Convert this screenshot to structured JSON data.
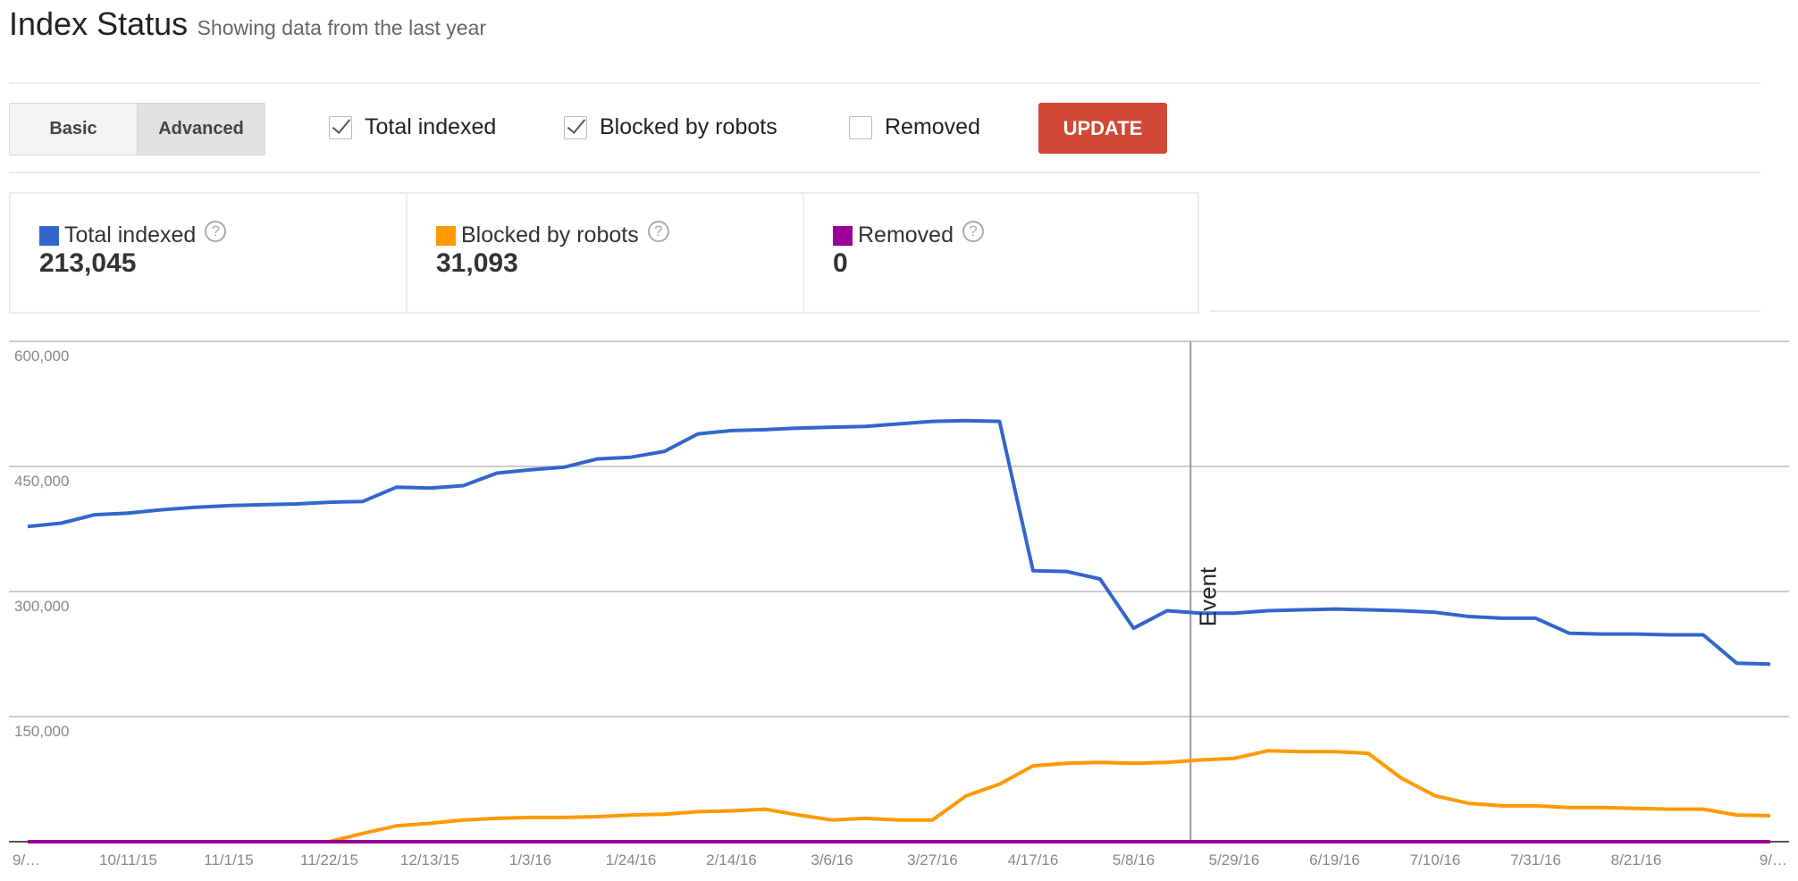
{
  "header": {
    "title": "Index Status",
    "subtitle": "Showing data from the last year"
  },
  "view_toggle": {
    "options": [
      "Basic",
      "Advanced"
    ],
    "selected": "Advanced"
  },
  "filters": [
    {
      "label": "Total indexed",
      "checked": true
    },
    {
      "label": "Blocked by robots",
      "checked": true
    },
    {
      "label": "Removed",
      "checked": false
    }
  ],
  "update_label": "UPDATE",
  "colors": {
    "total": "#3366cc",
    "blocked": "#ff9900",
    "removed": "#990099",
    "update": "#d14836"
  },
  "stats": [
    {
      "label": "Total indexed",
      "value": "213,045",
      "color": "#3366cc",
      "help": "?"
    },
    {
      "label": "Blocked by robots",
      "value": "31,093",
      "color": "#ff9900",
      "help": "?"
    },
    {
      "label": "Removed",
      "value": "0",
      "color": "#990099",
      "help": "?"
    }
  ],
  "chart_data": {
    "type": "line",
    "title": "",
    "xlabel": "",
    "ylabel": "",
    "ylim": [
      0,
      600000
    ],
    "yticks": [
      0,
      150000,
      300000,
      450000,
      600000
    ],
    "ytick_labels": [
      "",
      "150,000",
      "300,000",
      "450,000",
      "600,000"
    ],
    "x_tick_labels": [
      "9/…",
      "10/11/15",
      "11/1/15",
      "11/22/15",
      "12/13/15",
      "1/3/16",
      "1/24/16",
      "2/14/16",
      "3/6/16",
      "3/27/16",
      "4/17/16",
      "5/8/16",
      "5/29/16",
      "6/19/16",
      "7/10/16",
      "7/31/16",
      "8/21/16",
      "9/…"
    ],
    "x_tick_every": 3,
    "num_points": 53,
    "grid": true,
    "annotation": {
      "label": "Event",
      "at_index": 34.7
    },
    "series": [
      {
        "name": "Total indexed",
        "color": "#3366cc",
        "values": [
          378000,
          382000,
          392000,
          394000,
          398000,
          401000,
          403000,
          404000,
          405000,
          407000,
          408000,
          425000,
          424000,
          427000,
          442000,
          446000,
          449000,
          459000,
          461000,
          468000,
          489000,
          493000,
          494000,
          496000,
          497000,
          498000,
          501000,
          504000,
          505000,
          504000,
          325000,
          324000,
          315000,
          256000,
          277000,
          274000,
          274000,
          277000,
          278000,
          279000,
          278000,
          277000,
          275000,
          270000,
          268000,
          268000,
          250000,
          249000,
          249000,
          248000,
          248000,
          214000,
          213045
        ]
      },
      {
        "name": "Blocked by robots",
        "color": "#ff9900",
        "values": [
          0,
          0,
          0,
          0,
          0,
          0,
          0,
          0,
          0,
          0,
          10000,
          19000,
          22000,
          26000,
          28000,
          29000,
          29000,
          30000,
          32000,
          33000,
          36000,
          37000,
          39000,
          32000,
          26000,
          28000,
          26000,
          26000,
          55000,
          69000,
          91000,
          94000,
          95000,
          94000,
          95000,
          98000,
          100000,
          109000,
          108000,
          108000,
          106000,
          76000,
          55000,
          46000,
          43000,
          43000,
          41000,
          41000,
          40000,
          39000,
          39000,
          32000,
          31093
        ]
      },
      {
        "name": "Removed",
        "color": "#990099",
        "values": [
          0,
          0,
          0,
          0,
          0,
          0,
          0,
          0,
          0,
          0,
          0,
          0,
          0,
          0,
          0,
          0,
          0,
          0,
          0,
          0,
          0,
          0,
          0,
          0,
          0,
          0,
          0,
          0,
          0,
          0,
          0,
          0,
          0,
          0,
          0,
          0,
          0,
          0,
          0,
          0,
          0,
          0,
          0,
          0,
          0,
          0,
          0,
          0,
          0,
          0,
          0,
          0,
          0
        ]
      }
    ]
  }
}
